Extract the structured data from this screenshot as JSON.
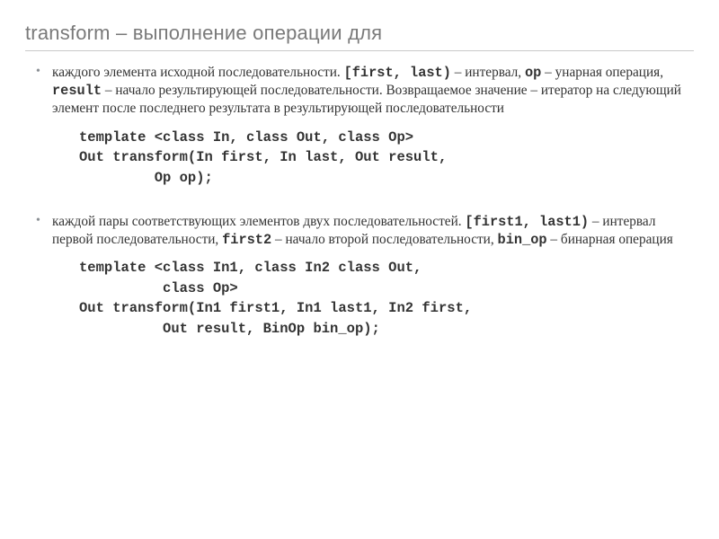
{
  "title": "transform – выполнение операции для",
  "bullet1": {
    "t0": "каждого элемента исходной последовательности. ",
    "c0": "[first, last)",
    "t1": " – интервал, ",
    "c1": "op",
    "t2": " – унарная операция, ",
    "c2": "result",
    "t3": " – начало результирующей последовательности. Возвращаемое значение – итератор на следующий элемент после последнего результата в результирующей последовательности"
  },
  "code1": {
    "l1": "template <class In, class Out, class Op>",
    "l2": "Out transform(In first, In last, Out result,",
    "l3": "         Op op);"
  },
  "bullet2": {
    "t0": "каждой пары соответствующих элементов двух последовательностей. ",
    "c0": "[first1, last1)",
    "t1": " – интервал первой последовательности, ",
    "c1": "first2",
    "t2": " – начало второй последовательности, ",
    "c2": "bin_op",
    "t3": " – бинарная операция"
  },
  "code2": {
    "l1": "template <class In1, class In2 class Out,",
    "l2": "          class Op>",
    "l3": "Out transform(In1 first1, In1 last1, In2 first,",
    "l4": "          Out result, BinOp bin_op);"
  }
}
